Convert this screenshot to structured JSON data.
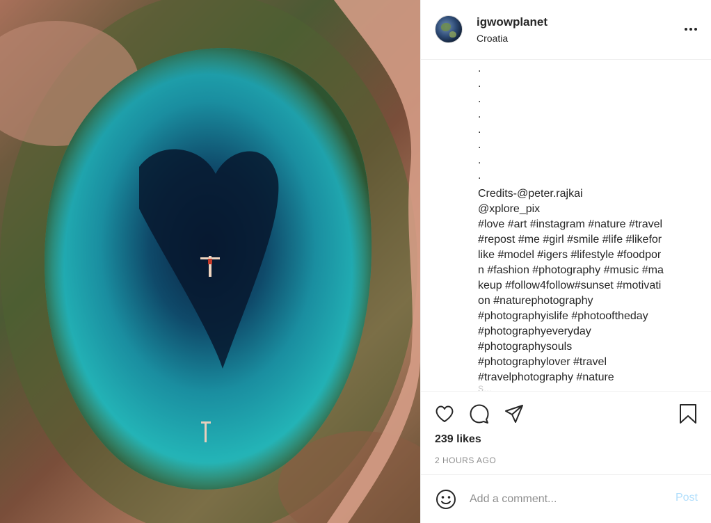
{
  "post": {
    "username": "igwowplanet",
    "location": "Croatia",
    "caption_dots": [
      ".",
      ".",
      ".",
      ".",
      ".",
      ".",
      ".",
      "."
    ],
    "caption_lines": [
      "Credits-@peter.rajkai",
      "@xplore_pix",
      "#love #art #instagram #nature #travel",
      "#repost #me #girl #smile #life #likefor",
      "like #model #igers #lifestyle #foodpor",
      "n #fashion #photography #music #ma",
      "keup #follow4follow#sunset #motivati",
      "on #naturephotography",
      "#photographyislife #photooftheday",
      "#photographyeveryday",
      "#photographysouls",
      "#photographylover #travel",
      "#travelphotography #nature"
    ],
    "likes": "239 likes",
    "time": "2 HOURS AGO"
  },
  "icons": {
    "more": "more-options-icon",
    "like": "heart-icon",
    "comment": "comment-bubble-icon",
    "share": "send-icon",
    "save": "bookmark-icon",
    "emoji": "emoji-icon"
  },
  "comment": {
    "placeholder": "Add a comment...",
    "post_label": "Post"
  },
  "colors": {
    "text": "#262626",
    "muted": "#8e8e8e",
    "divider": "#efefef",
    "post_disabled": "#b2dffc",
    "water_deep": "#0a2a4a",
    "water_turquoise": "#1aa5b4"
  }
}
